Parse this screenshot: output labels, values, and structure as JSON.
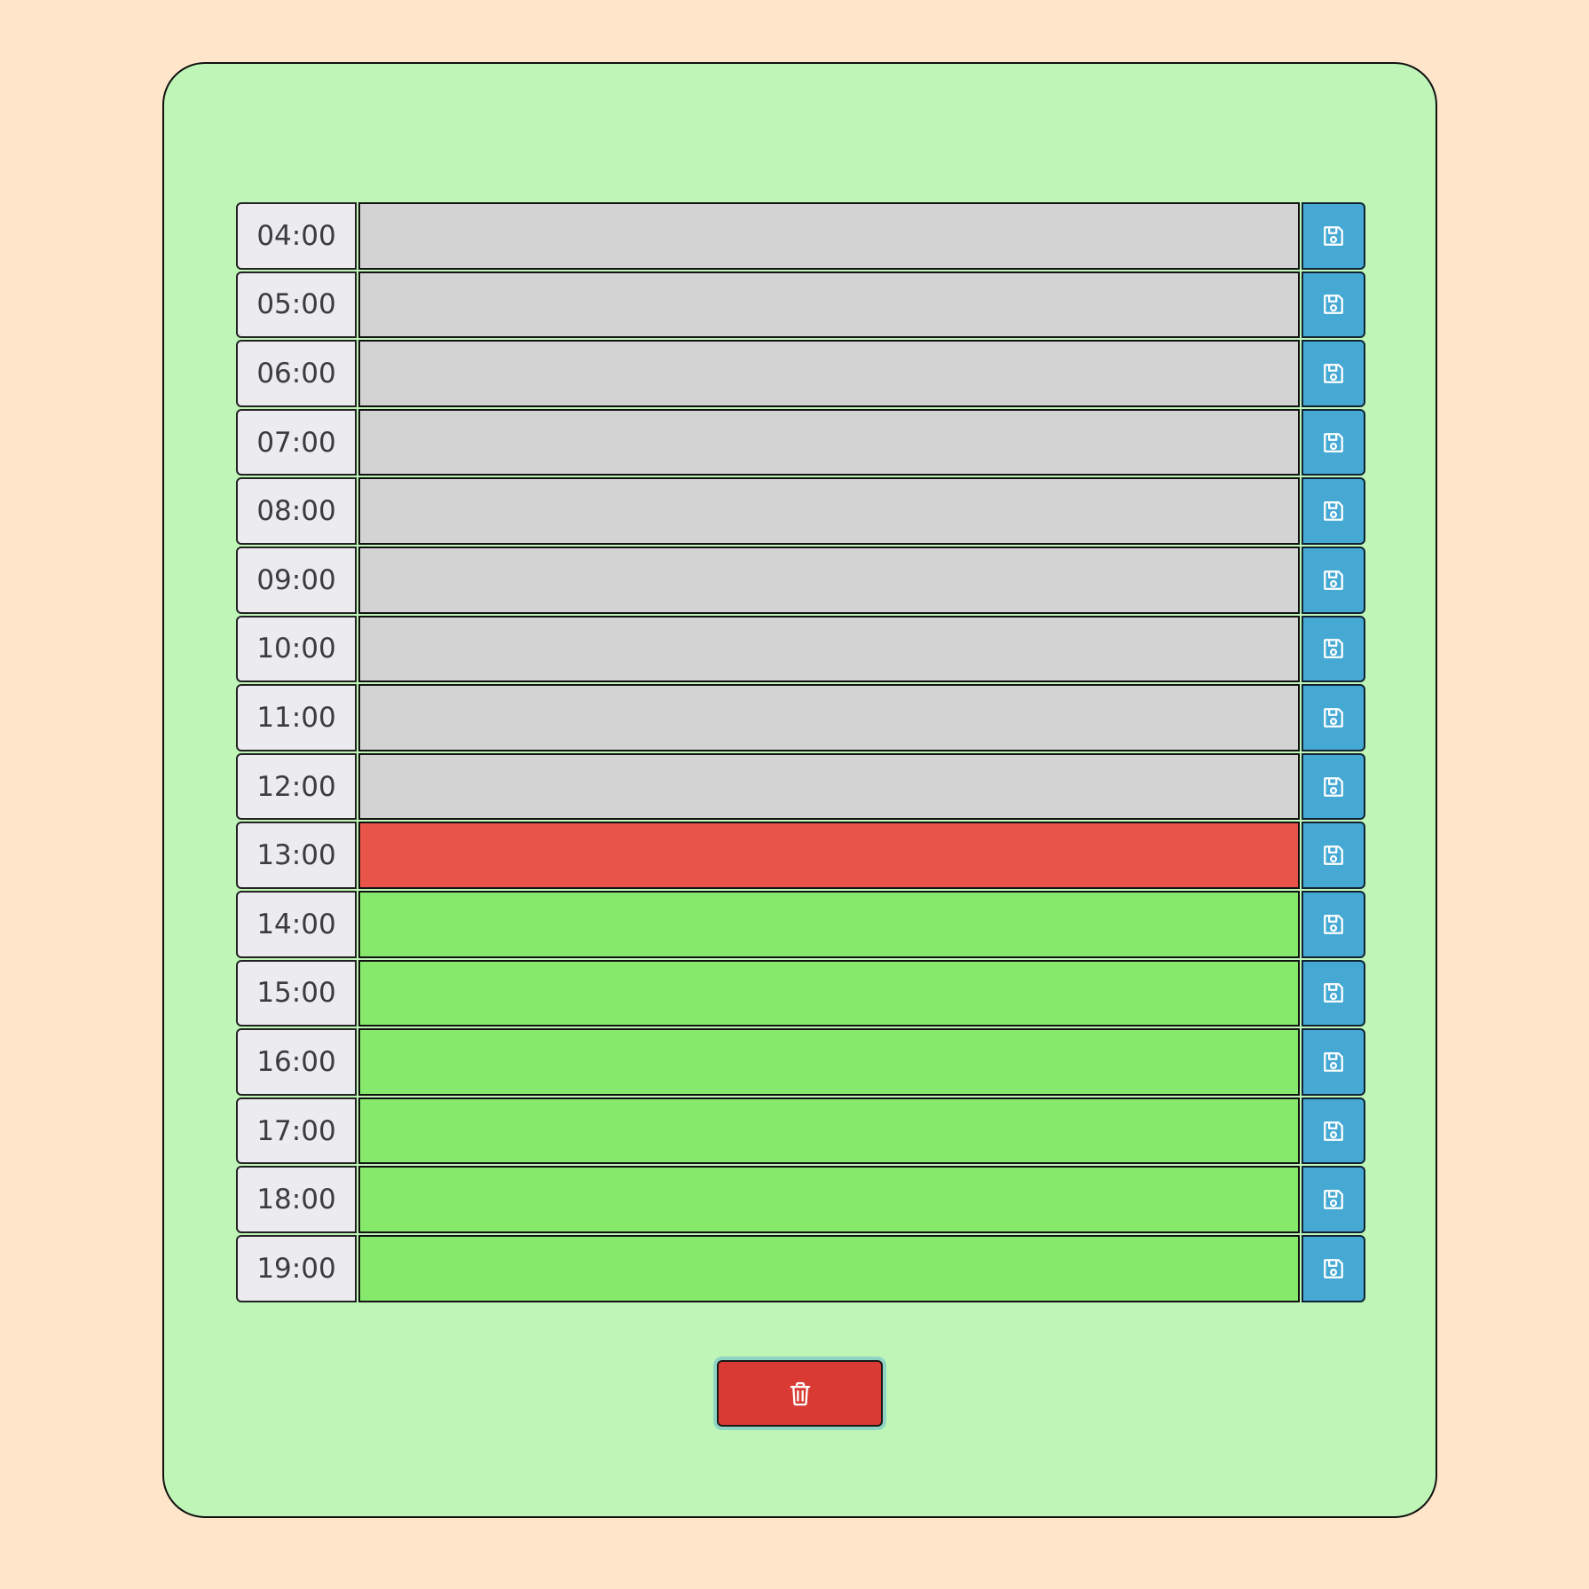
{
  "colors": {
    "page_background": "#ffe5c9",
    "card_background": "#bff6b8",
    "past": "#d3d3d3",
    "present": "#e8534a",
    "future": "#86e96b",
    "save_button": "#45a9d4",
    "clear_button": "#d93a33"
  },
  "schedule": {
    "rows": [
      {
        "hour": "04:00",
        "state": "past",
        "text": "",
        "save_icon": "floppy-disk-icon"
      },
      {
        "hour": "05:00",
        "state": "past",
        "text": "",
        "save_icon": "floppy-disk-icon"
      },
      {
        "hour": "06:00",
        "state": "past",
        "text": "",
        "save_icon": "floppy-disk-icon"
      },
      {
        "hour": "07:00",
        "state": "past",
        "text": "",
        "save_icon": "floppy-disk-icon"
      },
      {
        "hour": "08:00",
        "state": "past",
        "text": "",
        "save_icon": "floppy-disk-icon"
      },
      {
        "hour": "09:00",
        "state": "past",
        "text": "",
        "save_icon": "floppy-disk-icon"
      },
      {
        "hour": "10:00",
        "state": "past",
        "text": "",
        "save_icon": "floppy-disk-icon"
      },
      {
        "hour": "11:00",
        "state": "past",
        "text": "",
        "save_icon": "floppy-disk-icon"
      },
      {
        "hour": "12:00",
        "state": "past",
        "text": "",
        "save_icon": "floppy-disk-icon"
      },
      {
        "hour": "13:00",
        "state": "present",
        "text": "",
        "save_icon": "floppy-disk-icon"
      },
      {
        "hour": "14:00",
        "state": "future",
        "text": "",
        "save_icon": "floppy-disk-icon"
      },
      {
        "hour": "15:00",
        "state": "future",
        "text": "",
        "save_icon": "floppy-disk-icon"
      },
      {
        "hour": "16:00",
        "state": "future",
        "text": "",
        "save_icon": "floppy-disk-icon"
      },
      {
        "hour": "17:00",
        "state": "future",
        "text": "",
        "save_icon": "floppy-disk-icon"
      },
      {
        "hour": "18:00",
        "state": "future",
        "text": "",
        "save_icon": "floppy-disk-icon"
      },
      {
        "hour": "19:00",
        "state": "future",
        "text": "",
        "save_icon": "floppy-disk-icon"
      }
    ]
  },
  "clear_button": {
    "icon": "trash-icon"
  }
}
